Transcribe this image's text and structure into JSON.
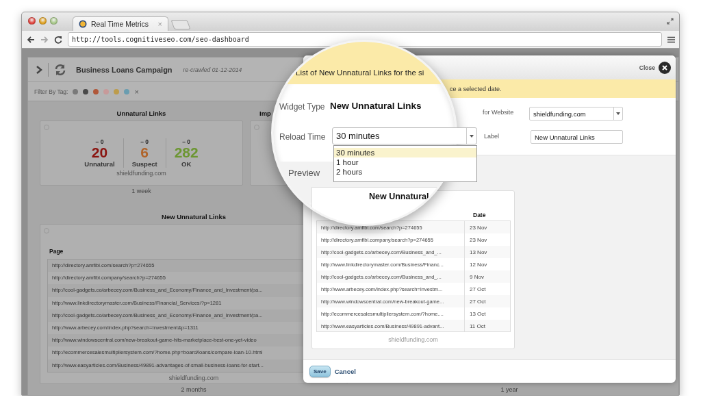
{
  "browser": {
    "tab_title": "Real Time Metrics",
    "tab_close": "×",
    "url": "http://tools.cognitiveseo.com/seo-dashboard"
  },
  "dashboard": {
    "campaign": "Business Loans Campaign",
    "crawled": "re-crawled 01-12-2014",
    "filter_label": "Filter By Tag:",
    "clear": "×",
    "tags": [
      {
        "color": "#7a7a7a"
      },
      {
        "color": "#4a4a4a"
      },
      {
        "color": "#b0583a"
      },
      {
        "color": "#c79a9a"
      },
      {
        "color": "#bd9c4c"
      },
      {
        "color": "#6a9db0"
      }
    ],
    "stats_widget": {
      "title": "Unnatural Links",
      "selected": false,
      "site": "shieldfunding.com",
      "period": "1 week",
      "stats": [
        {
          "delta": "– 0",
          "value": "20",
          "label": "Unnatural",
          "color": "#8a1410"
        },
        {
          "delta": "– 0",
          "value": "6",
          "label": "Suspect",
          "color": "#b0642a"
        },
        {
          "delta": "– 0",
          "value": "282",
          "label": "OK",
          "color": "#6c9632"
        }
      ]
    },
    "partial_widget": {
      "title": "Imp",
      "selected": false
    },
    "links_widget": {
      "title": "New Unnatural Links",
      "selected": false,
      "column": "Page",
      "site": "shieldfunding.com",
      "period": "2 months",
      "rows": [
        "http://directory.amfibi.com/search?p=274655",
        "http://directory.amfibi.company/search?p=274655",
        "http://cool-gadgets.co/arbecey.com/Business_and_Economy/Finance_and_Investment/pa...",
        "http://www.linkdirectorymaster.com/Business/Financial_Services/?p=1281",
        "http://cool-gadgets.co/arbecey.com/Business_and_Economy/Finance_and_Investment/pa...",
        "http://www.arbecey.com/index.php?search=Investment&p=1311",
        "http://www.windowscentral.com/new-breakout-game-hits-marketplace-best-one-yet-video",
        "http://ecommercesalesmultipliersystem.com/?home.php=board/loans/compare-loan-10.html",
        "http://www.easyarticles.com/Business/49891-advantages-of-small-business-loans-for-start..."
      ]
    },
    "right_period": "1 year"
  },
  "modal": {
    "title": "List of New Unnatural Links for the si",
    "notice": "ce a selected date.",
    "close": "Close",
    "widget_type_label": "Widget Type",
    "widget_type": "New Unnatural Links",
    "reload_label": "Reload Time",
    "reload_value": "30 minutes",
    "reload_options": [
      {
        "label": "30 minutes",
        "selected": true
      },
      {
        "label": "1 hour",
        "selected": false
      },
      {
        "label": "2 hours",
        "selected": false
      }
    ],
    "website_label": "for Website",
    "website": "shieldfunding.com",
    "label_label": "Label",
    "label_value": "New Unnatural Links",
    "preview_label": "Preview",
    "preview": {
      "title": "New Unnatural",
      "date_column": "Date",
      "site": "shieldfunding.com",
      "rows": [
        {
          "page": "http://directory.amfibi.com/search?p=274655",
          "date": "23 Nov"
        },
        {
          "page": "http://directory.amfibi.company/search?p=274655",
          "date": "23 Nov"
        },
        {
          "page": "http://cool-gadgets.co/arbecey.com/Business_and_...",
          "date": "13 Nov"
        },
        {
          "page": "http://www.linkdirectorymaster.com/Business/Financ...",
          "date": "12 Nov"
        },
        {
          "page": "http://cool-gadgets.co/arbecey.com/Business_and_...",
          "date": "9 Nov"
        },
        {
          "page": "http://www.arbecey.com/index.php?search=Investm...",
          "date": "27 Oct"
        },
        {
          "page": "http://www.windowscentral.com/new-breakout-game...",
          "date": "27 Oct"
        },
        {
          "page": "http://ecommercesalesmultipliersystem.com/?home....",
          "date": "13 Oct"
        },
        {
          "page": "http://www.easyarticles.com/Business/49891-advant...",
          "date": "11 Oct"
        }
      ]
    },
    "save": "Save",
    "cancel": "Cancel"
  }
}
